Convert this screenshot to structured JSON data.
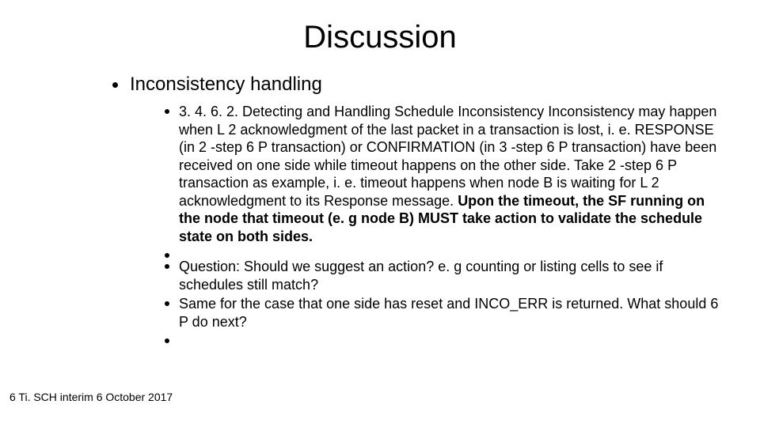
{
  "title": "Discussion",
  "l1_heading": "Inconsistency handling",
  "items": {
    "i0a": "3. 4. 6. 2. Detecting and Handling Schedule Inconsistency Inconsistency may happen when L 2 acknowledgment of the last packet in a transaction is lost, i. e. RESPONSE (in 2 -step 6 P transaction) or CONFIRMATION (in 3 -step 6 P transaction) have been received on one side while timeout happens on the other side. Take 2 -step 6 P transaction as example, i. e. timeout happens when node B is waiting for L 2 acknowledgment to its Response message. ",
    "i0b": "Upon the timeout, the SF running on the node that timeout (e. g node B) MUST take action to validate the schedule state on both sides.",
    "i1": "",
    "i2": "Question: Should we suggest an action? e. g counting or listing cells to see if schedules still match?",
    "i3": "Same for the case that one side has reset and INCO_ERR is returned. What should 6 P do next?",
    "i4": ""
  },
  "footer": "6 Ti. SCH interim 6 October 2017"
}
